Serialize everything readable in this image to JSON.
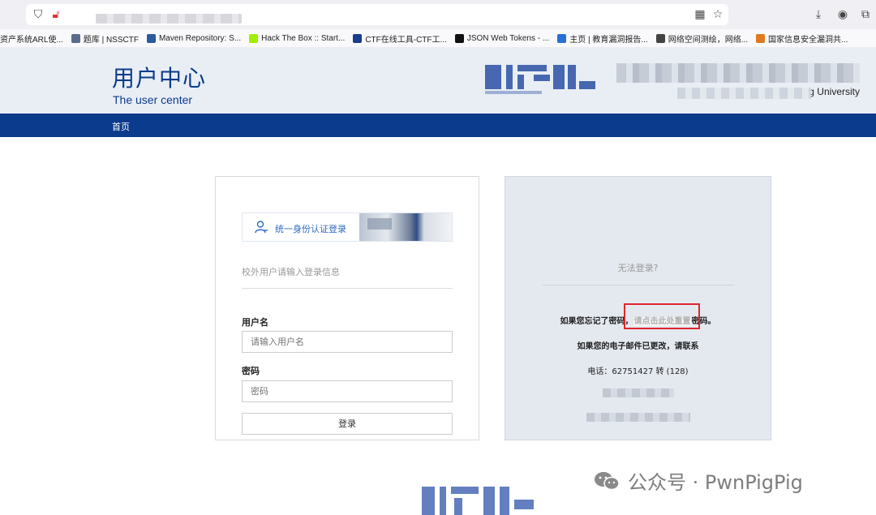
{
  "browser": {
    "bookmarks": [
      {
        "label": "资产系统ARL使...",
        "color": "#c0392b"
      },
      {
        "label": "题库 | NSSCTF",
        "color": "#5b6b8c"
      },
      {
        "label": "Maven Repository: S...",
        "color": "#2c5aa0"
      },
      {
        "label": "Hack The Box :: Start...",
        "color": "#9fef00"
      },
      {
        "label": "CTF在线工具-CTF工...",
        "color": "#1a3d8f"
      },
      {
        "label": "JSON Web Tokens - ...",
        "color": "#111111"
      },
      {
        "label": "主页 | 教育漏洞报告...",
        "color": "#2a6fd6"
      },
      {
        "label": "网络空间测绘，网络...",
        "color": "#444444"
      },
      {
        "label": "国家信息安全漏洞共...",
        "color": "#e07a1f"
      }
    ]
  },
  "header": {
    "title": "用户中心",
    "subtitle": "The user center",
    "university_suffix": "n Mi               ng University"
  },
  "nav": {
    "home": "首页"
  },
  "login": {
    "sso_label": "统一身份认证登录",
    "hint": "校外用户请输入登录信息",
    "username_label": "用户名",
    "username_placeholder": "请输入用户名",
    "password_label": "密码",
    "password_placeholder": "密码",
    "submit_label": "登录"
  },
  "help": {
    "title": "无法登录?",
    "forgot_prefix": "如果您忘记了密码，",
    "reset_link": "请点击此处重置",
    "forgot_suffix": "密码。",
    "email_changed": "如果您的电子邮件已更改，请联系",
    "phone": "电话：62751427 转 (128)"
  },
  "watermark": {
    "text": "公众号 · PwnPigPig"
  }
}
